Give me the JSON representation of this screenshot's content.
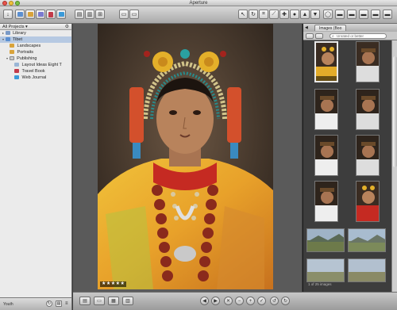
{
  "window": {
    "title": "Aperture"
  },
  "toolbar": {
    "buttons": [
      "import-icon",
      "new-project-icon",
      "new-album-icon",
      "new-smart-album-icon",
      "new-book-icon",
      "new-webpage-icon",
      "stack-icon",
      "compare-icon",
      "select-icon",
      "rotate-icon",
      "crop-icon",
      "straighten-icon",
      "patch-icon",
      "red-eye-icon",
      "lift-stamp-icon",
      "loupe-icon",
      "main-viewer-icon",
      "fullscreen-icon",
      "view-mode-icon",
      "inspector-icon"
    ]
  },
  "sidebar": {
    "header": "All Projects",
    "items": [
      {
        "label": "Library",
        "indent": 0,
        "icon": "library-icon",
        "selected": false
      },
      {
        "label": "Tibet",
        "indent": 0,
        "icon": "project-icon",
        "selected": true
      },
      {
        "label": "Landscapes",
        "indent": 1,
        "icon": "album-icon",
        "selected": false
      },
      {
        "label": "Portraits",
        "indent": 1,
        "icon": "album-icon",
        "selected": false
      },
      {
        "label": "Publishing",
        "indent": 1,
        "icon": "folder-icon",
        "selected": false
      },
      {
        "label": "Layout Ideas Eight T",
        "indent": 2,
        "icon": "light-table-icon",
        "selected": false
      },
      {
        "label": "Travel Book",
        "indent": 2,
        "icon": "book-icon",
        "selected": false
      },
      {
        "label": "Web Journal",
        "indent": 2,
        "icon": "web-journal-icon",
        "selected": false
      }
    ],
    "footer_label": "Youth"
  },
  "viewer": {
    "rating": "★★★★★"
  },
  "browser": {
    "tabs": [
      "Images (Boo",
      "Tibet"
    ],
    "search_placeholder": "Unrated or better",
    "pagination": "1 of 25 images"
  },
  "colors": {
    "selection": "#b6c9e2",
    "chrome_light": "#d8d8d8",
    "viewer_bg": "#5a5a5a"
  }
}
